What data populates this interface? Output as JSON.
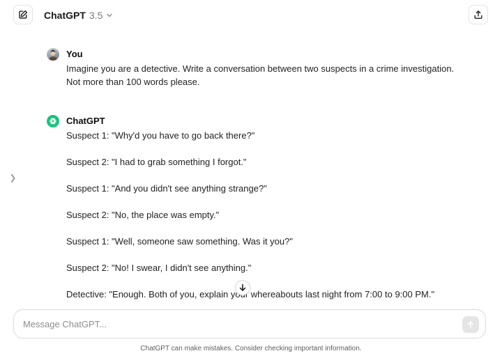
{
  "header": {
    "new_chat_icon": "edit-square-icon",
    "model_name": "ChatGPT",
    "model_version": "3.5",
    "model_dropdown_icon": "chevron-down-icon",
    "share_icon": "share-upload-icon"
  },
  "sidebar": {
    "toggle_icon": "chevron-right-icon"
  },
  "conversation": {
    "user_message": {
      "author": "You",
      "lines": [
        "Imagine you are a detective. Write a conversation between two suspects in a crime investigation.",
        "Not more than 100 words please."
      ]
    },
    "assistant_message": {
      "author": "ChatGPT",
      "paragraphs": [
        "Suspect 1: \"Why'd you have to go back there?\"",
        "Suspect 2: \"I had to grab something I forgot.\"",
        "Suspect 1: \"And you didn't see anything strange?\"",
        "Suspect 2: \"No, the place was empty.\"",
        "Suspect 1: \"Well, someone saw something. Was it you?\"",
        "Suspect 2: \"No! I swear, I didn't see anything.\"",
        "Detective: \"Enough. Both of you, explain your whereabouts last night from 7:00 to 9:00 PM.\""
      ]
    }
  },
  "scroll_down_icon": "arrow-down-icon",
  "composer": {
    "placeholder": "Message ChatGPT...",
    "value": "",
    "send_icon": "arrow-up-icon"
  },
  "footer": {
    "disclaimer": "ChatGPT can make mistakes. Consider checking important information."
  },
  "colors": {
    "assistant_avatar": "#19c37d",
    "send_button_disabled": "#e5e5e5",
    "border": "#d9d9d9"
  }
}
